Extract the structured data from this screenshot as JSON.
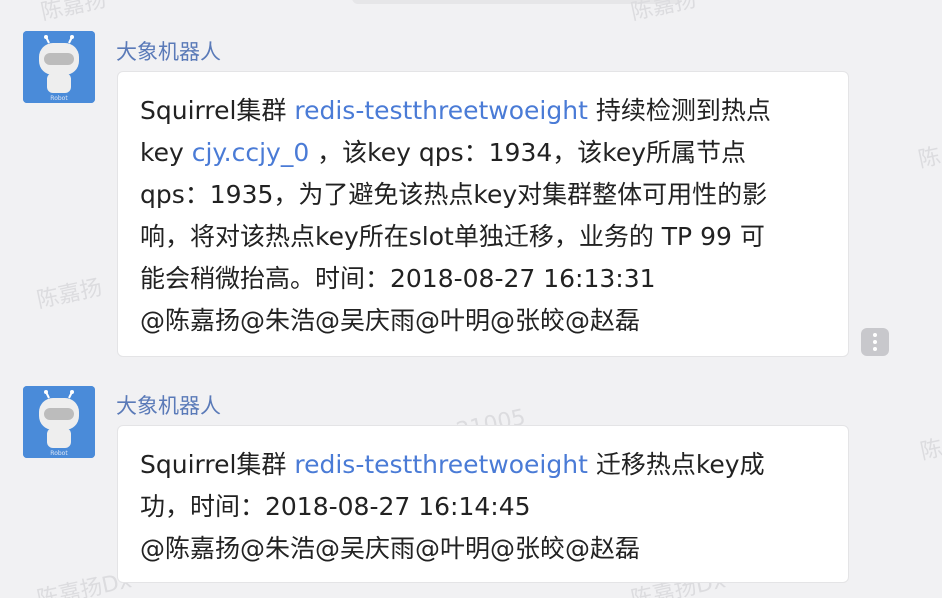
{
  "watermark": {
    "text_a": "陈嘉扬",
    "text_b": "陈嘉扬Dx",
    "text_c": "陈嘉扬021005",
    "text_d": "21005",
    "text_e": "陈"
  },
  "messages": [
    {
      "sender": "大象机器人",
      "avatar_label": "Robot",
      "lines": [
        {
          "parts": [
            "Squirrel集群 ",
            "redis-testthreetwoeight",
            " 持续检测到热点"
          ]
        },
        {
          "parts": [
            "key ",
            "cjy.ccjy_0",
            " ，该key qps：1934，该key所属节点"
          ]
        },
        {
          "text": "qps：1935，为了避免该热点key对集群整体可用性的影"
        },
        {
          "text": "响，将对该热点key所在slot单独迁移，业务的 TP 99 可"
        },
        {
          "text": "能会稍微抬高。时间：2018-08-27 16:13:31"
        },
        {
          "text": "@陈嘉扬@朱浩@吴庆雨@叶明@张皎@赵磊"
        }
      ]
    },
    {
      "sender": "大象机器人",
      "avatar_label": "Robot",
      "lines": [
        {
          "parts": [
            "Squirrel集群 ",
            "redis-testthreetwoeight",
            " 迁移热点key成"
          ]
        },
        {
          "text": "功，时间：2018-08-27 16:14:45"
        },
        {
          "text": "@陈嘉扬@朱浩@吴庆雨@叶明@张皎@赵磊"
        }
      ]
    }
  ],
  "colors": {
    "background": "#f1f1f3",
    "sender_name": "#5a7ab8",
    "link": "#4a7bd6",
    "avatar_bg": "#4a8bd9",
    "text": "#222222"
  },
  "icons": {
    "avatar": "robot-avatar-icon",
    "more": "more-vertical-icon"
  }
}
